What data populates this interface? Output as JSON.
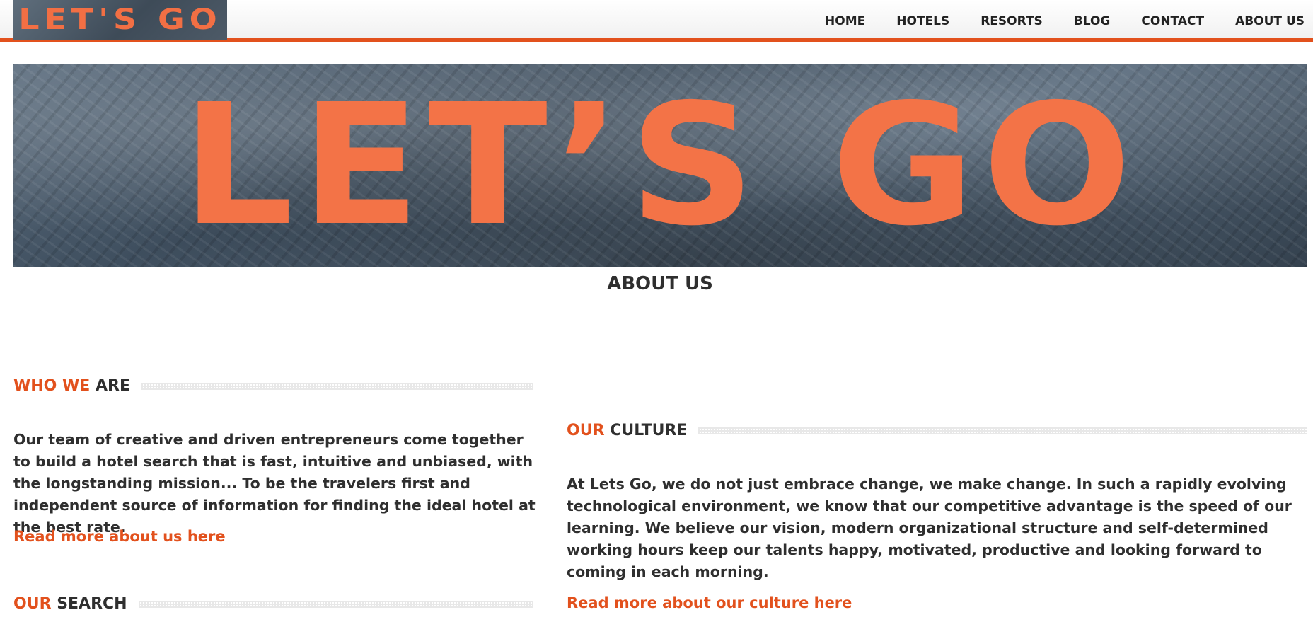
{
  "header": {
    "logo_text": "LET'S GO",
    "nav": [
      {
        "label": "HOME"
      },
      {
        "label": "HOTELS"
      },
      {
        "label": "RESORTS"
      },
      {
        "label": "BLOG"
      },
      {
        "label": "CONTACT"
      },
      {
        "label": "ABOUT US"
      }
    ]
  },
  "hero": {
    "title": "LET’S GO"
  },
  "page": {
    "title": "ABOUT US"
  },
  "who_we_are": {
    "heading_accent": "WHO WE",
    "heading_rest": "ARE",
    "text": "Our team of creative and driven entrepreneurs come together to build a hotel search that is fast, intuitive and unbiased, with the longstanding mission... To be the travelers first and independent source of information for finding the ideal hotel at the best rate.",
    "link": "Read more about us here"
  },
  "our_search": {
    "heading_accent": "OUR",
    "heading_rest": "SEARCH"
  },
  "our_culture": {
    "heading_accent": "OUR",
    "heading_rest": "CULTURE",
    "text": "At Lets Go, we do not just embrace change, we make change. In such a rapidly evolving technological environment, we know that our competitive advantage is the speed of our learning. We believe our vision, modern organizational structure and self-determined working hours keep our talents happy, motivated, productive and looking forward to coming in each morning.",
    "link": "Read more about our culture here"
  },
  "colors": {
    "accent": "#e2511d",
    "hero_text": "#f37347",
    "text": "#2f2f2f"
  }
}
